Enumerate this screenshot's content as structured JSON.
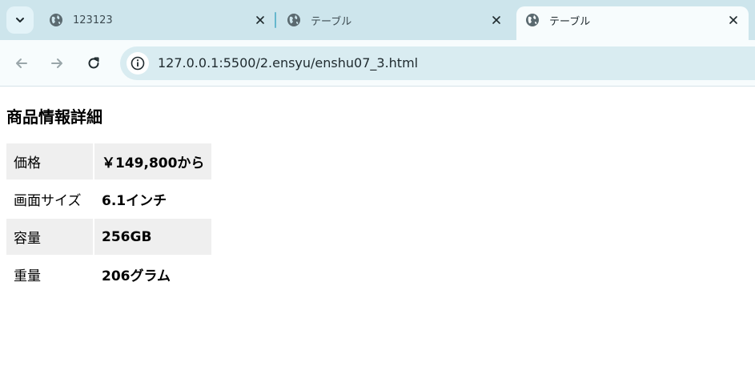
{
  "browser": {
    "tabs": [
      {
        "title": "123123",
        "icon": "globe-icon",
        "active": false
      },
      {
        "title": "テーブル",
        "icon": "globe-icon",
        "active": false
      },
      {
        "title": "テーブル",
        "icon": "globe-icon",
        "active": true
      }
    ],
    "url": "127.0.0.1:5500/2.ensyu/enshu07_3.html",
    "accent_color": "#cde5ec"
  },
  "page": {
    "heading": "商品情報詳細",
    "rows": [
      {
        "label": "価格",
        "value": "￥149,800から"
      },
      {
        "label": "画面サイズ",
        "value": "6.1インチ"
      },
      {
        "label": "容量",
        "value": "256GB"
      },
      {
        "label": "重量",
        "value": "206グラム"
      }
    ]
  }
}
